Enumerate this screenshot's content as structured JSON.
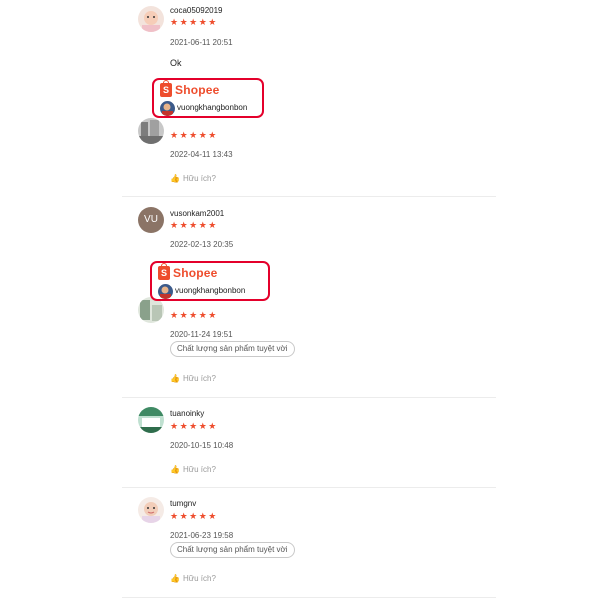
{
  "reviews": [
    {
      "username": "coca05092019",
      "stars": "★★★★★",
      "timestamp": "2021-06-11 20:51",
      "comment": "Ok"
    },
    {
      "username": "",
      "stars": "★★★★★",
      "timestamp": "2022-04-11 13:43",
      "helpful": "Hữu ích?"
    },
    {
      "username": "vusonkam2001",
      "avatar_initials": "VU",
      "stars": "★★★★★",
      "timestamp": "2022-02-13 20:35"
    },
    {
      "username": "",
      "stars": "★★★★★",
      "timestamp": "2020-11-24 19:51",
      "tag": "Chất lượng sản phẩm tuyệt vời",
      "helpful": "Hữu ích?"
    },
    {
      "username": "tuanoinky",
      "stars": "★★★★★",
      "timestamp": "2020-10-15 10:48",
      "helpful": "Hữu ích?"
    },
    {
      "username": "tumgnv",
      "stars": "★★★★★",
      "timestamp": "2021-06-23 19:58",
      "tag": "Chất lượng sản phẩm tuyệt vời",
      "helpful": "Hữu ích?"
    }
  ],
  "shopee_badges": [
    {
      "brand": "Shopee",
      "shop_name": "vuongkhangbonbon",
      "bag_letter": "S"
    },
    {
      "brand": "Shopee",
      "shop_name": "vuongkhangbonbon",
      "bag_letter": "S"
    }
  ],
  "icons": {
    "thumb": "thumbs-up-icon",
    "star": "star-icon"
  },
  "colors": {
    "accent": "#ee4d2d",
    "badge_border": "#e4002b"
  }
}
